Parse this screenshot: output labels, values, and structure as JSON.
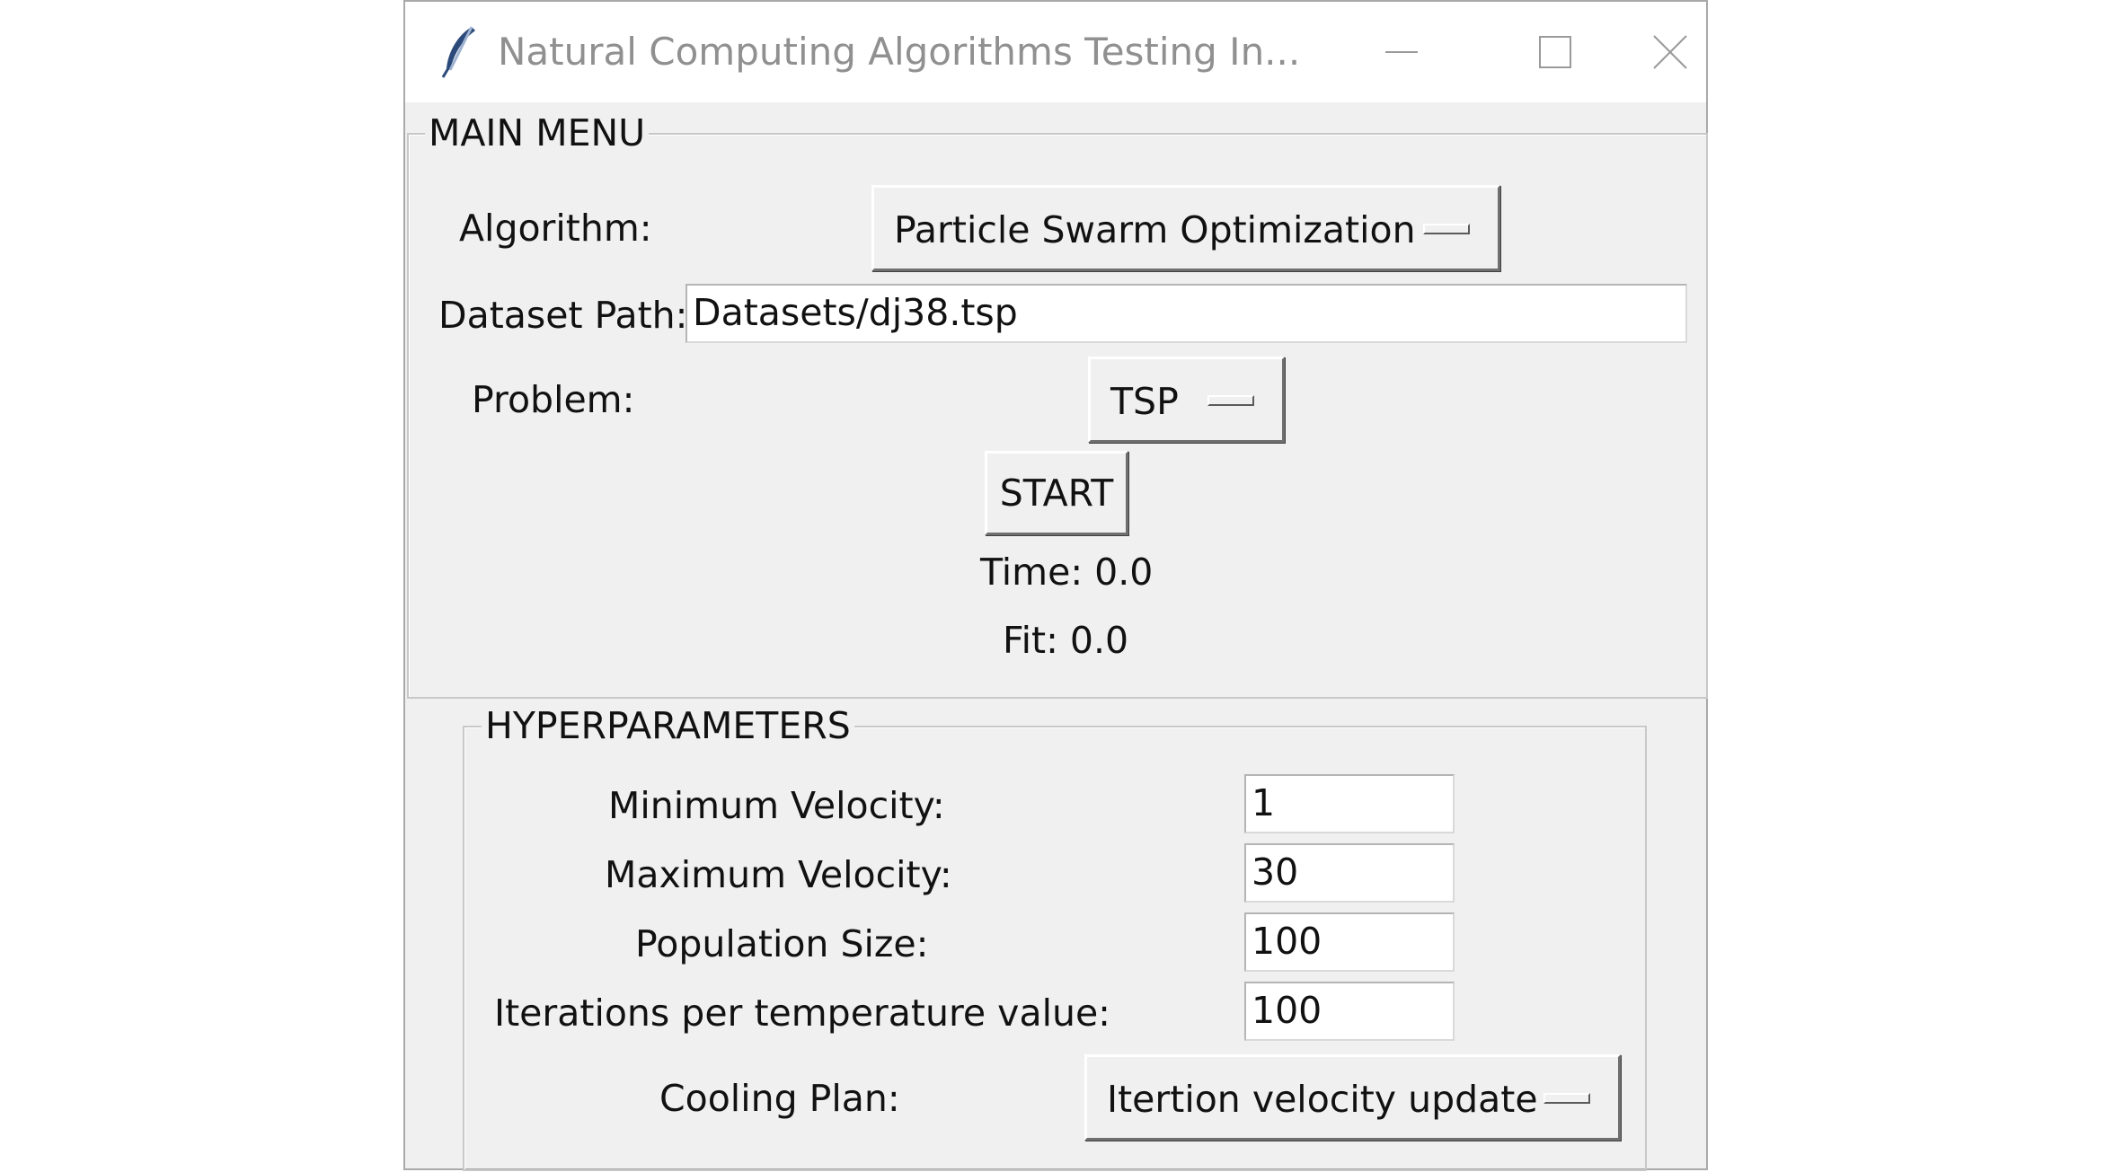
{
  "window": {
    "title": "Natural Computing Algorithms Testing In...",
    "icon": "feather-icon"
  },
  "main_menu": {
    "legend": "MAIN MENU",
    "algorithm_label": "Algorithm:",
    "algorithm_value": "Particle Swarm Optimization",
    "dataset_label": "Dataset Path:",
    "dataset_value": "Datasets/dj38.tsp",
    "problem_label": "Problem:",
    "problem_value": "TSP",
    "start_label": "START",
    "time_text": "Time: 0.0",
    "fit_text": "Fit: 0.0"
  },
  "hyperparameters": {
    "legend": "HYPERPARAMETERS",
    "min_velocity_label": "Minimum Velocity:",
    "min_velocity_value": "1",
    "max_velocity_label": "Maximum Velocity:",
    "max_velocity_value": "30",
    "population_label": "Population Size:",
    "population_value": "100",
    "iterations_label": "Iterations per temperature value:",
    "iterations_value": "100",
    "cooling_label": "Cooling Plan:",
    "cooling_value": "Itertion velocity update"
  }
}
